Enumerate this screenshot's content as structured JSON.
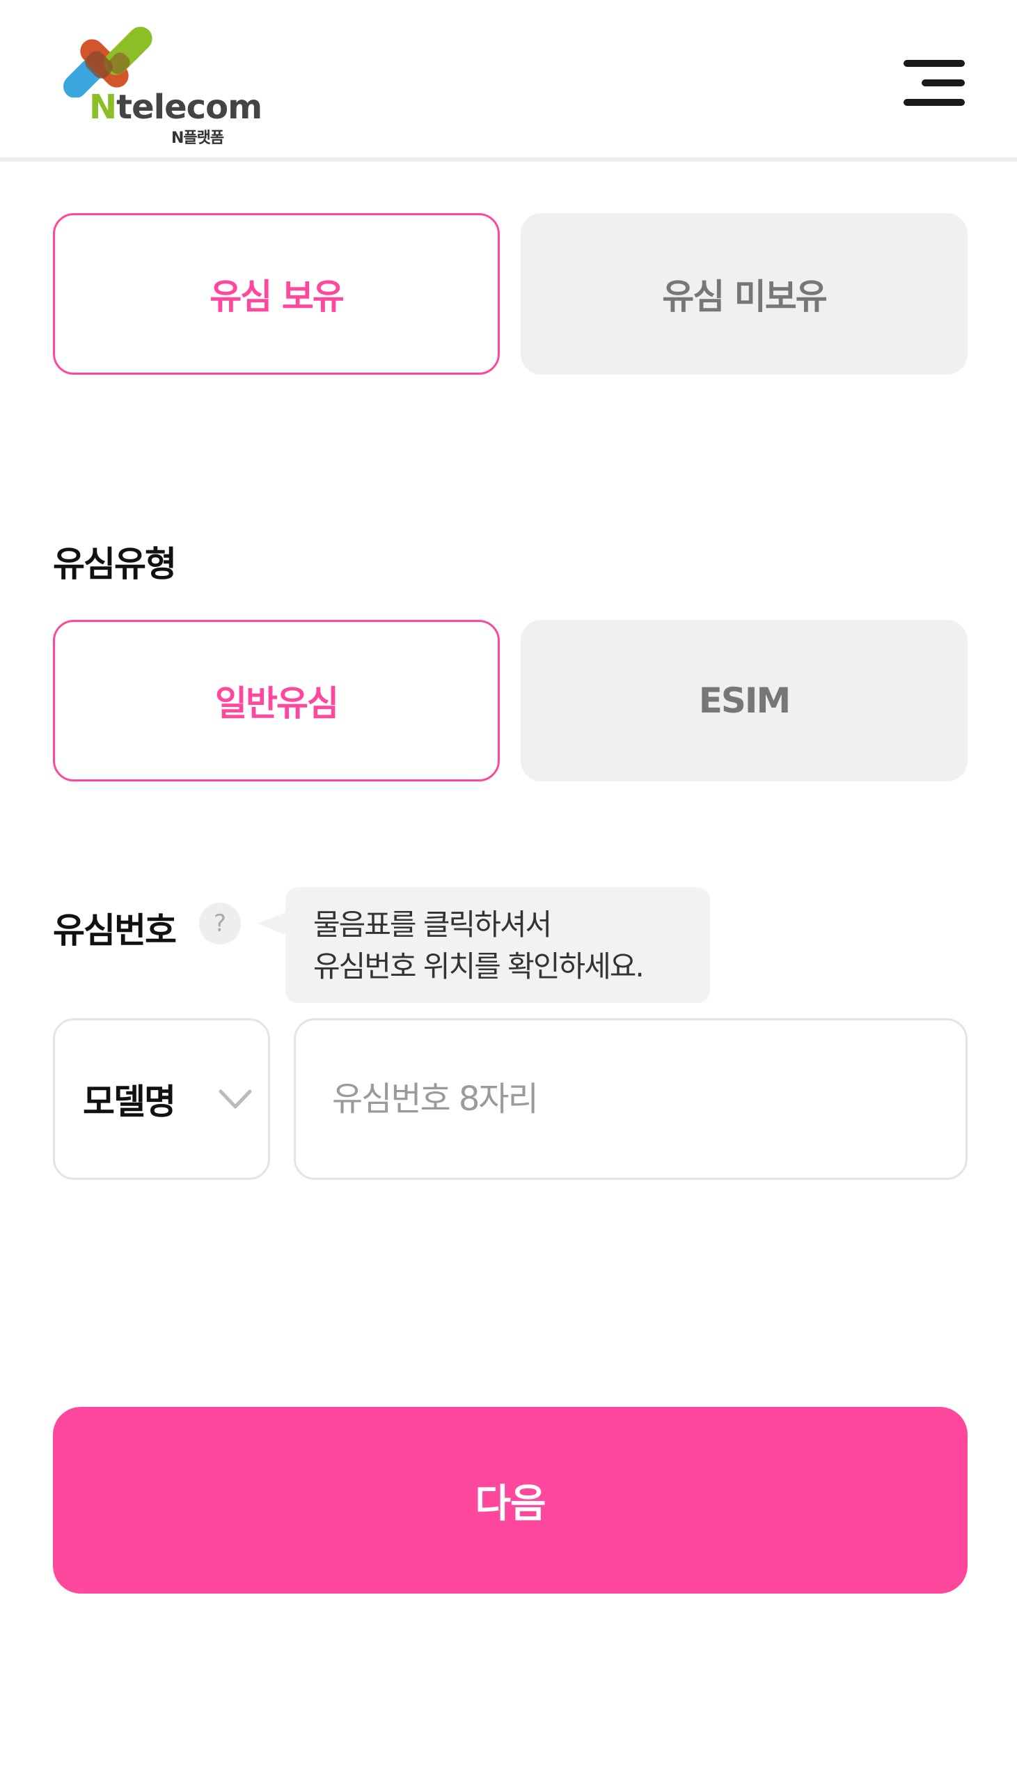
{
  "header": {
    "logo_text_n": "N",
    "logo_text_rest": "telecom",
    "logo_sub": "N플랫폼",
    "menu_icon": "hamburger-menu-icon"
  },
  "sim_ownership": {
    "options": [
      {
        "label": "유심 보유",
        "selected": true
      },
      {
        "label": "유심 미보유",
        "selected": false
      }
    ]
  },
  "sim_type": {
    "label": "유심유형",
    "options": [
      {
        "label": "일반유심",
        "selected": true
      },
      {
        "label": "ESIM",
        "selected": false
      }
    ]
  },
  "sim_number": {
    "label": "유심번호",
    "help_icon_glyph": "?",
    "tooltip_line1": "물음표를 클릭하셔서",
    "tooltip_line2": "유심번호 위치를 확인하세요.",
    "model_select": "모델명",
    "input_placeholder": "유심번호 8자리",
    "input_value": ""
  },
  "next_button": "다음",
  "colors": {
    "accent": "#ff479e",
    "inactive_bg": "#f0f0f0",
    "inactive_text": "#777777",
    "border": "#e4e4e4"
  }
}
